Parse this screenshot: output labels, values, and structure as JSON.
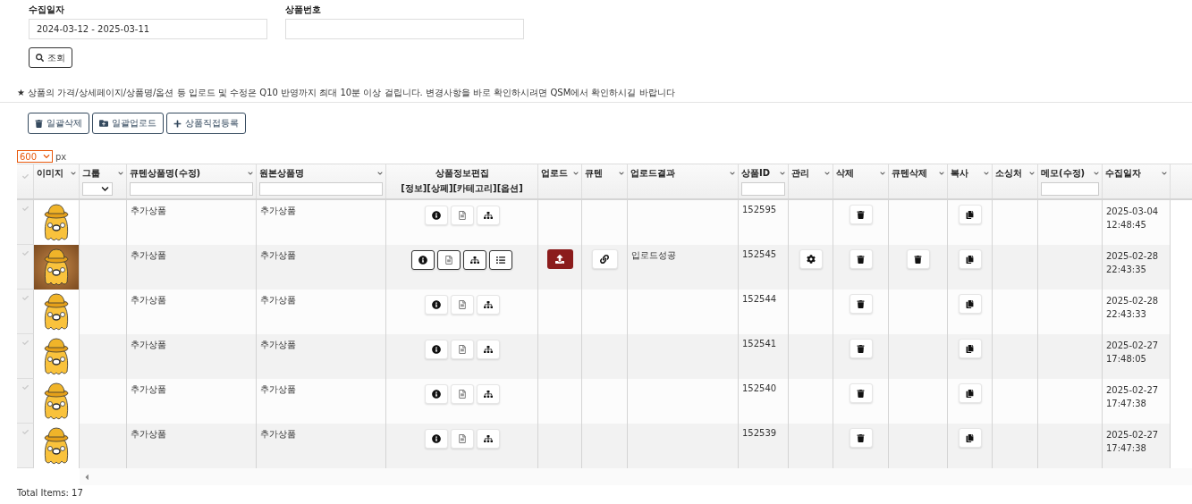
{
  "search": {
    "fields": [
      {
        "label": "수집일자",
        "value": "2024-03-12 - 2025-03-11"
      },
      {
        "label": "상품번호"
      }
    ],
    "button": "조회"
  },
  "notice": "★ 상품의 가격/상세페이지/상품명/옵션 등 입로드 및 수정은 Q10 반영까지 최대 10분 이상 걸립니다. 변경사항을 바로 확인하시려면 QSM에서 확인하시길 바랍니다",
  "actions": [
    {
      "kind": "delete",
      "label": "일괄삭제"
    },
    {
      "kind": "upload",
      "label": "일괄업로드"
    },
    {
      "kind": "add",
      "label": "상품직접등록"
    }
  ],
  "size_select": {
    "value": "600",
    "unit": "px"
  },
  "table": {
    "columns": [
      {
        "label": "이미지",
        "kind": "plain"
      },
      {
        "label": "그룹",
        "kind": "select"
      },
      {
        "label": "큐텐상품명(수정)",
        "kind": "text"
      },
      {
        "label": "원본상품명",
        "kind": "text"
      },
      {
        "label": "상품정보편집",
        "sublabel": "[정보][상페][카테고리][옵션]",
        "kind": "double"
      },
      {
        "label": "업로드",
        "kind": "plain"
      },
      {
        "label": "큐텐",
        "kind": "plain"
      },
      {
        "label": "업로드결과",
        "kind": "plain"
      },
      {
        "label": "상품ID",
        "kind": "text"
      },
      {
        "label": "관리",
        "kind": "plain"
      },
      {
        "label": "삭제",
        "kind": "plain"
      },
      {
        "label": "큐텐삭제",
        "kind": "plain"
      },
      {
        "label": "복사",
        "kind": "plain"
      },
      {
        "label": "소싱처",
        "kind": "plain"
      },
      {
        "label": "메모(수정)",
        "kind": "text"
      },
      {
        "label": "수집일자",
        "kind": "plain"
      }
    ],
    "rows": [
      {
        "selected": false,
        "photo_background": false,
        "highlighted": false,
        "qoo10_name": "추가상품",
        "original_name": "추가상품",
        "edit_buttons": [
          {
            "kind": "info"
          },
          {
            "kind": "detail"
          },
          {
            "kind": "category"
          }
        ],
        "upload_button": false,
        "qoo10_link": false,
        "product_id": "152595",
        "manage_button": false,
        "qoo10_delete_button": false,
        "collected_at": "2025-03-04 12:48:45"
      },
      {
        "selected": false,
        "photo_background": true,
        "highlighted": true,
        "qoo10_name": "추가상품",
        "original_name": "추가상품",
        "edit_buttons": [
          {
            "kind": "info"
          },
          {
            "kind": "detail"
          },
          {
            "kind": "category"
          },
          {
            "kind": "options"
          }
        ],
        "upload_button": true,
        "qoo10_link": true,
        "upload_result": "입로드성공",
        "product_id": "152545",
        "manage_button": true,
        "qoo10_delete_button": true,
        "collected_at": "2025-02-28 22:43:35"
      },
      {
        "selected": false,
        "photo_background": false,
        "highlighted": false,
        "qoo10_name": "추가상품",
        "original_name": "추가상품",
        "edit_buttons": [
          {
            "kind": "info"
          },
          {
            "kind": "detail"
          },
          {
            "kind": "category"
          }
        ],
        "upload_button": false,
        "qoo10_link": false,
        "product_id": "152544",
        "manage_button": false,
        "qoo10_delete_button": false,
        "collected_at": "2025-02-28 22:43:33"
      },
      {
        "selected": false,
        "photo_background": false,
        "highlighted": false,
        "qoo10_name": "추가상품",
        "original_name": "추가상품",
        "edit_buttons": [
          {
            "kind": "info"
          },
          {
            "kind": "detail"
          },
          {
            "kind": "category"
          }
        ],
        "upload_button": false,
        "qoo10_link": false,
        "product_id": "152541",
        "manage_button": false,
        "qoo10_delete_button": false,
        "collected_at": "2025-02-27 17:48:05"
      },
      {
        "selected": false,
        "photo_background": false,
        "highlighted": false,
        "qoo10_name": "추가상품",
        "original_name": "추가상품",
        "edit_buttons": [
          {
            "kind": "info"
          },
          {
            "kind": "detail"
          },
          {
            "kind": "category"
          }
        ],
        "upload_button": false,
        "qoo10_link": false,
        "product_id": "152540",
        "manage_button": false,
        "qoo10_delete_button": false,
        "collected_at": "2025-02-27 17:47:38"
      },
      {
        "selected": false,
        "photo_background": false,
        "highlighted": false,
        "qoo10_name": "추가상품",
        "original_name": "추가상품",
        "edit_buttons": [
          {
            "kind": "info"
          },
          {
            "kind": "detail"
          },
          {
            "kind": "category"
          }
        ],
        "upload_button": false,
        "qoo10_link": false,
        "product_id": "152539",
        "manage_button": false,
        "qoo10_delete_button": false,
        "collected_at": "2025-02-27 17:47:38"
      }
    ]
  },
  "total": "Total Items: 17"
}
